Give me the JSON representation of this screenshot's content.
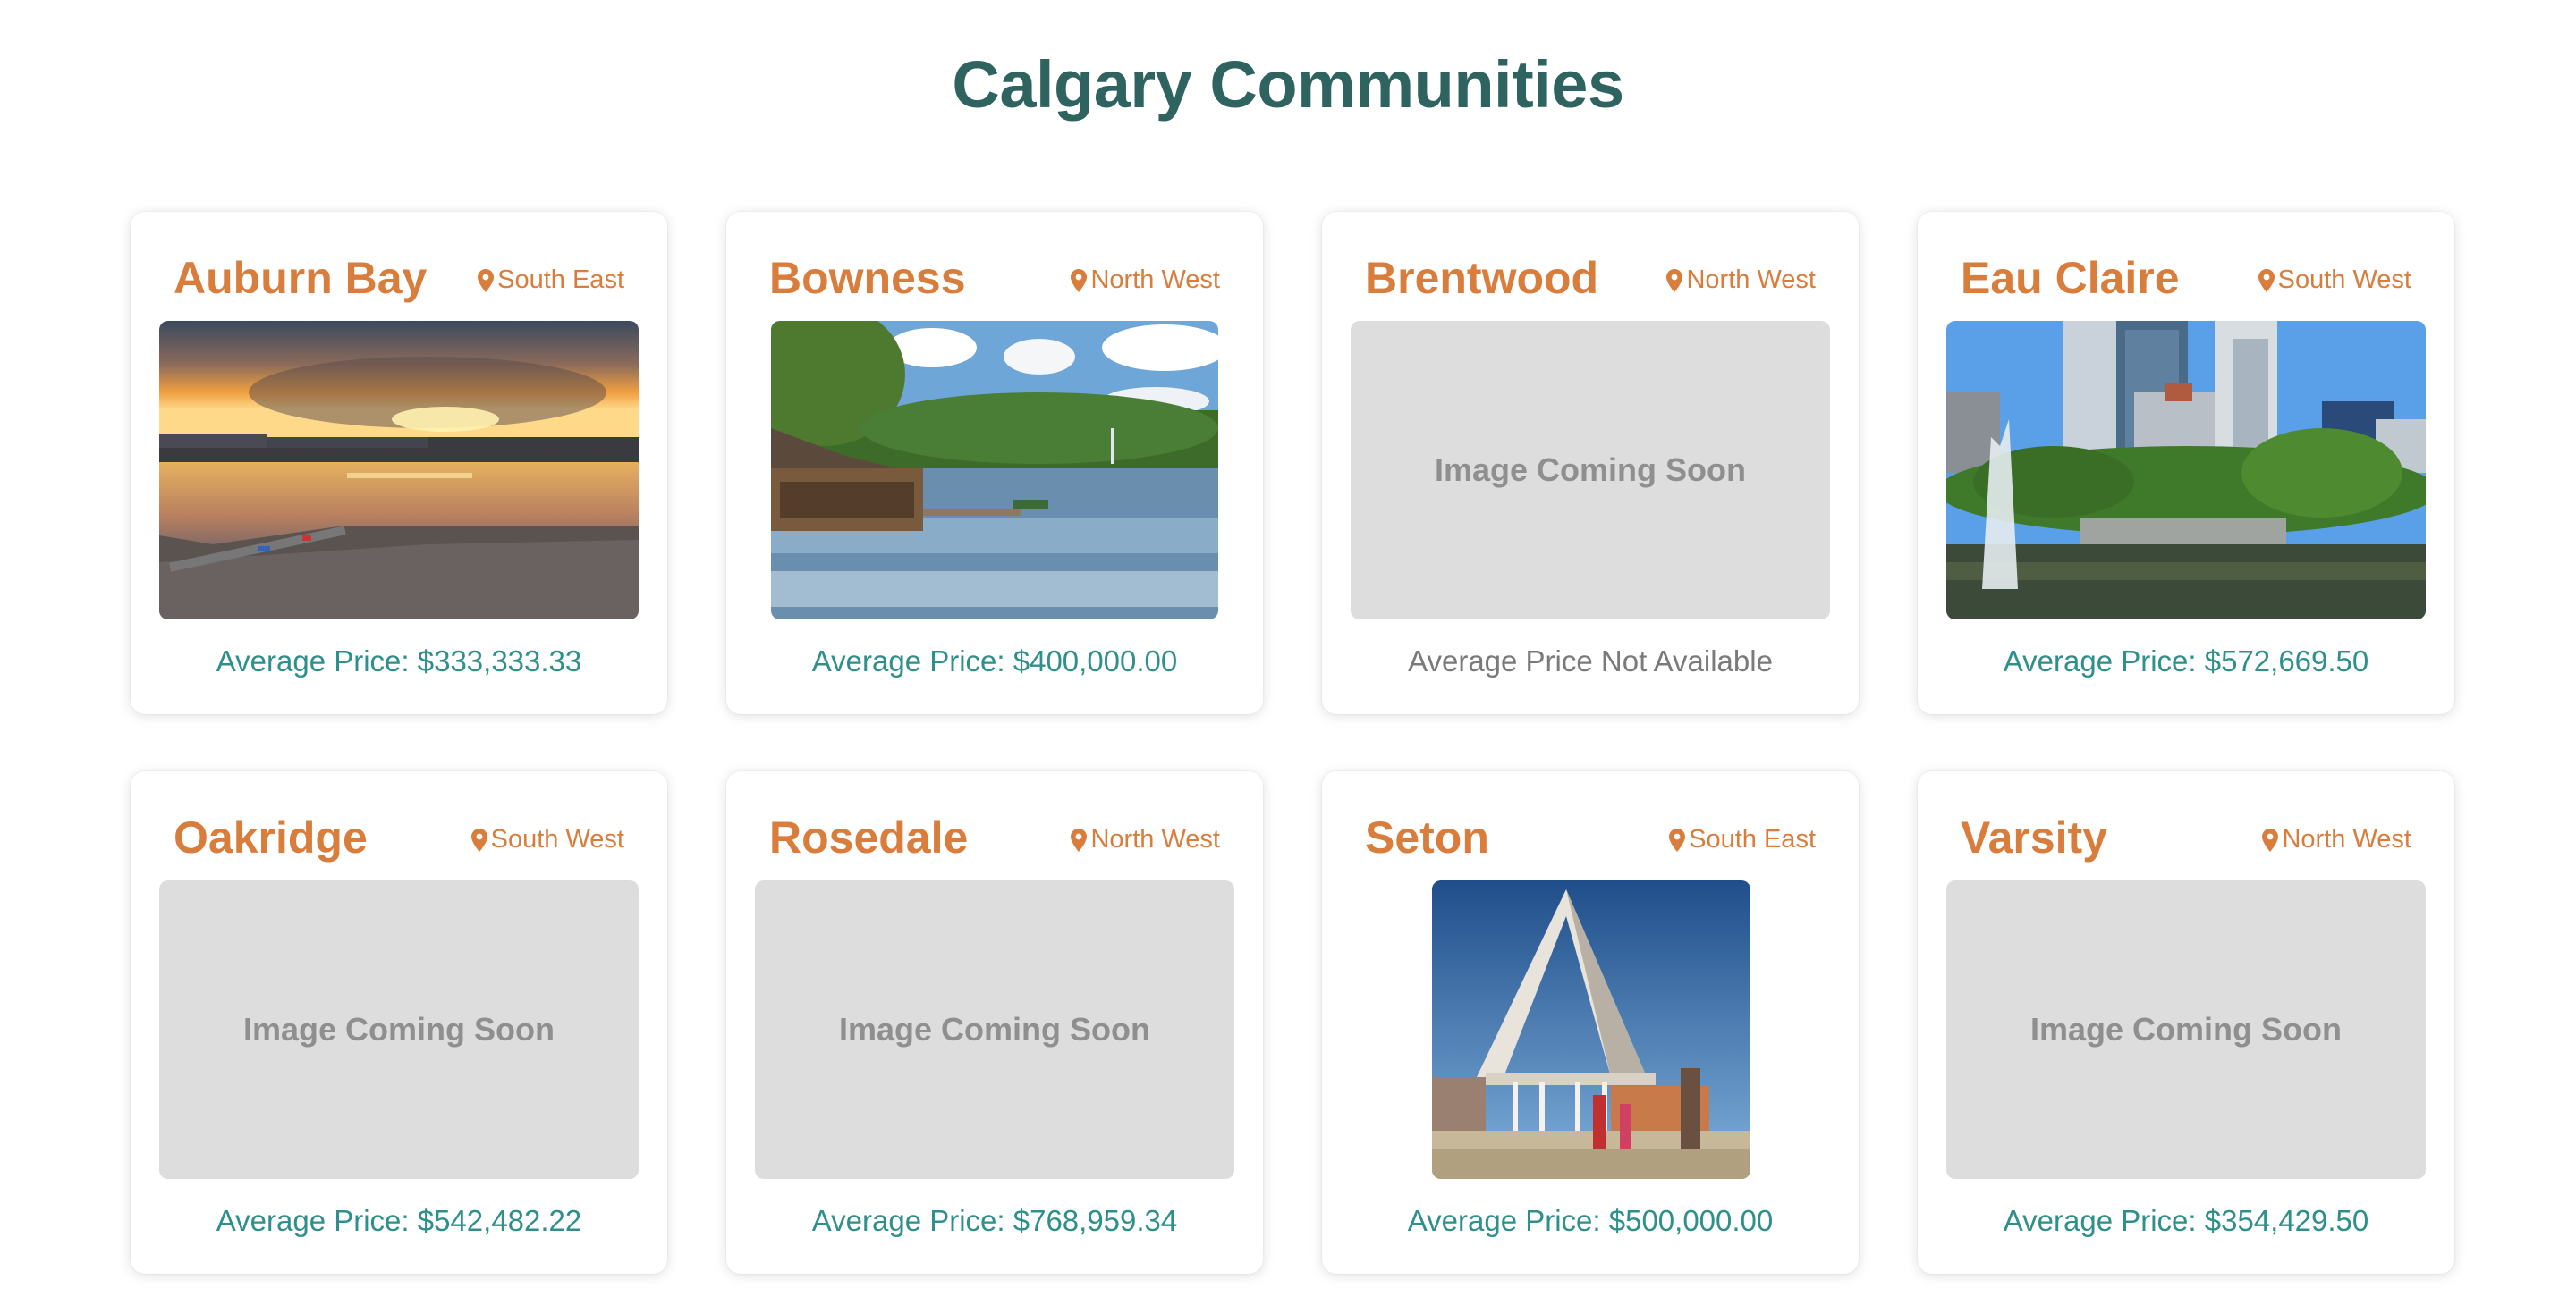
{
  "page": {
    "title": "Calgary Communities"
  },
  "placeholder_text": "Image Coming Soon",
  "colors": {
    "title": "#2e6360",
    "accent": "#d97d3d",
    "price": "#2f8f8a",
    "placeholder_bg": "#dddddd"
  },
  "communities": [
    {
      "name": "Auburn Bay",
      "location": "South East",
      "price": "Average Price: $333,333.33",
      "image": "sunset-lake-photo"
    },
    {
      "name": "Bowness",
      "location": "North West",
      "price": "Average Price: $400,000.00",
      "image": "park-lagoon-photo"
    },
    {
      "name": "Brentwood",
      "location": "North West",
      "price": "Average Price Not Available",
      "image": "placeholder"
    },
    {
      "name": "Eau Claire",
      "location": "South West",
      "price": "Average Price: $572,669.50",
      "image": "downtown-fountain-photo"
    },
    {
      "name": "Oakridge",
      "location": "South West",
      "price": "Average Price: $542,482.22",
      "image": "placeholder"
    },
    {
      "name": "Rosedale",
      "location": "North West",
      "price": "Average Price: $768,959.34",
      "image": "placeholder"
    },
    {
      "name": "Seton",
      "location": "South East",
      "price": "Average Price: $500,000.00",
      "image": "rec-centre-photo"
    },
    {
      "name": "Varsity",
      "location": "North West",
      "price": "Average Price: $354,429.50",
      "image": "placeholder"
    }
  ]
}
